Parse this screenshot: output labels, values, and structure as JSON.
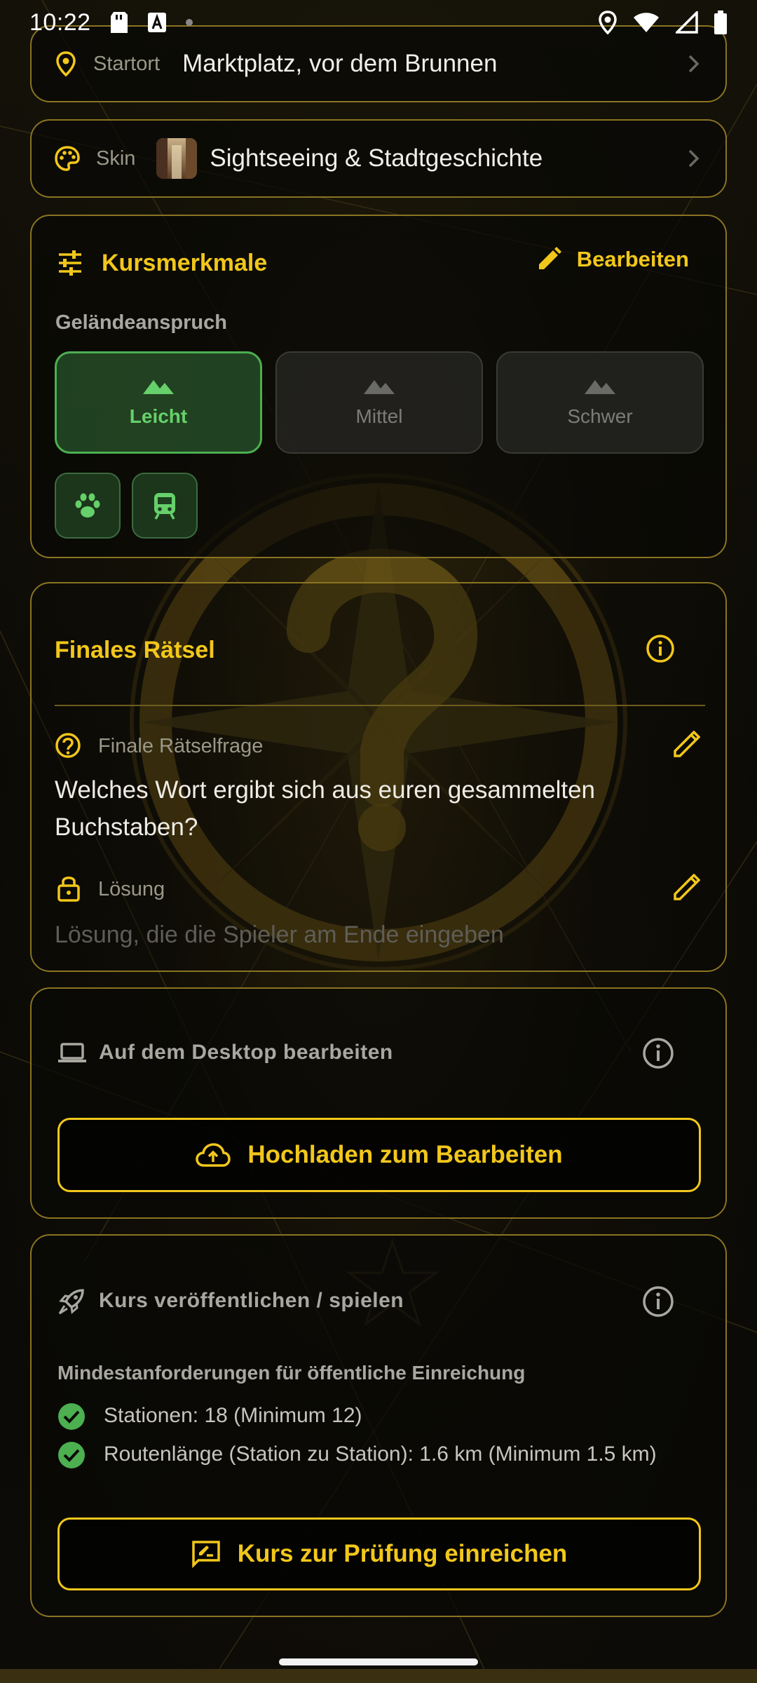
{
  "status_bar": {
    "time": "10:22"
  },
  "startort": {
    "label": "Startort",
    "value": "Marktplatz, vor dem Brunnen",
    "icon": "location-pin-icon"
  },
  "skin": {
    "label": "Skin",
    "value": "Sightseeing & Stadtgeschichte",
    "icon": "palette-icon"
  },
  "kursmerkmale": {
    "title": "Kursmerkmale",
    "edit_label": "Bearbeiten",
    "terrain_label": "Geländeanspruch",
    "difficulty": [
      {
        "label": "Leicht",
        "selected": true
      },
      {
        "label": "Mittel",
        "selected": false
      },
      {
        "label": "Schwer",
        "selected": false
      }
    ],
    "feature_chips": [
      "paw-icon",
      "train-icon"
    ]
  },
  "finales_raetsel": {
    "title": "Finales Rätsel",
    "question_label": "Finale Rätselfrage",
    "question_value": "Welches Wort ergibt sich aus euren gesammelten Buchstaben?",
    "solution_label": "Lösung",
    "solution_placeholder": "Lösung, die die Spieler am Ende eingeben"
  },
  "desktop": {
    "title": "Auf dem Desktop bearbeiten",
    "button_label": "Hochladen zum Bearbeiten"
  },
  "publish": {
    "title": "Kurs veröffentlichen / spielen",
    "requirements_heading": "Mindestanforderungen für öffentliche Einreichung",
    "requirements": [
      {
        "text": "Stationen: 18 (Minimum 12)",
        "met": true
      },
      {
        "text": "Routenlänge (Station zu Station): 1.6 km (Minimum 1.5 km)",
        "met": true
      }
    ],
    "button_label": "Kurs zur Prüfung einreichen"
  },
  "colors": {
    "accent": "#f2c71b",
    "card_border": "#8a7422",
    "success": "#4caf50",
    "muted_text": "#9a9888"
  }
}
